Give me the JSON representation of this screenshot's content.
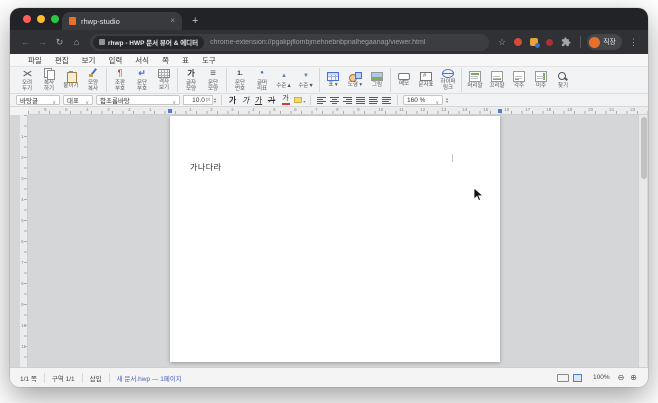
{
  "colors": {
    "accent_blue": "#4a7fd4",
    "favicon_orange": "#e8702a",
    "highlight_yellow": "#f3d96b",
    "char_color_red": "#d43b2a"
  },
  "icons": {
    "back": "←",
    "forward": "→",
    "reload": "↻",
    "home": "⌂",
    "star": "☆",
    "more": "⋮",
    "tab_close": "×",
    "new_tab": "+",
    "caret": "∨",
    "spin_up": "▴",
    "spin_down": "▾",
    "zoom_out": "⊖",
    "zoom_in": "⊕"
  },
  "browser": {
    "tab_title": "rhwp-studio",
    "extension_badge": "rhwp - HWP 문서 뷰어 & 에디터",
    "url": "chrome-extension://pgakpjflombjmehnebnbpnalhegaanag/viewer.html",
    "profile_label": "직장"
  },
  "menu": {
    "items": [
      {
        "id": "file",
        "label": "파일"
      },
      {
        "id": "edit",
        "label": "편집"
      },
      {
        "id": "view",
        "label": "보기"
      },
      {
        "id": "input",
        "label": "입력"
      },
      {
        "id": "format",
        "label": "서식"
      },
      {
        "id": "page",
        "label": "쪽"
      },
      {
        "id": "table",
        "label": "표"
      },
      {
        "id": "tools",
        "label": "도구"
      }
    ]
  },
  "toolbar": {
    "groups": [
      {
        "items": [
          {
            "name": "cut",
            "icon": "scissors-icon",
            "label": "오려\n두기"
          },
          {
            "name": "copy",
            "icon": "copy-icon",
            "label": "복사\n하기"
          },
          {
            "name": "paste",
            "icon": "paste-icon",
            "label": "붙이기"
          },
          {
            "name": "format-copy",
            "icon": "format-brush-icon",
            "label": "모양\n복사"
          }
        ]
      },
      {
        "items": [
          {
            "name": "control-marks",
            "icon": "pilcrow-icon",
            "label": "조판\n부호"
          },
          {
            "name": "paragraph-marks",
            "icon": "return-icon",
            "label": "문단\n부호"
          },
          {
            "name": "grid-view",
            "icon": "grid-view-icon",
            "label": "격자\n보기"
          }
        ]
      },
      {
        "items": [
          {
            "name": "char-shape",
            "icon": "char-shape-icon",
            "label": "글자\n모양"
          },
          {
            "name": "para-shape",
            "icon": "para-shape-icon",
            "label": "문단\n모양"
          }
        ]
      },
      {
        "items": [
          {
            "name": "para-numbering",
            "icon": "numbering-icon",
            "label": "문단\n번호"
          },
          {
            "name": "bullet-list",
            "icon": "bullet-icon",
            "label": "글머\n리표"
          },
          {
            "name": "level-up",
            "icon": "level-up-icon",
            "label": "수준▲"
          },
          {
            "name": "level-down",
            "icon": "level-down-icon",
            "label": "수준▼"
          }
        ]
      },
      {
        "items": [
          {
            "name": "insert-table",
            "icon": "table-icon",
            "label": "표 ▾"
          },
          {
            "name": "insert-shape",
            "icon": "shapes-icon",
            "label": "도형 ▾"
          },
          {
            "name": "insert-picture",
            "icon": "picture-icon",
            "label": "그림"
          }
        ]
      },
      {
        "items": [
          {
            "name": "memo",
            "icon": "memo-icon",
            "label": "메모"
          },
          {
            "name": "char-map",
            "icon": "charmap-icon",
            "label": "문자표"
          },
          {
            "name": "hyperlink",
            "icon": "hyperlink-icon",
            "label": "하이퍼\n링크"
          }
        ]
      },
      {
        "items": [
          {
            "name": "header",
            "icon": "header-icon",
            "label": "머리말"
          },
          {
            "name": "footer",
            "icon": "footer-icon",
            "label": "꼬리말"
          },
          {
            "name": "footnote",
            "icon": "footnote-icon",
            "label": "각주"
          },
          {
            "name": "endnote",
            "icon": "endnote-icon",
            "label": "미주"
          },
          {
            "name": "find",
            "icon": "find-icon",
            "label": "찾기"
          }
        ]
      }
    ]
  },
  "format_bar": {
    "style_value": "바탕글",
    "lang_value": "대표",
    "font_value": "함초롬바탕",
    "size_value": "10.0",
    "size_unit": "pt",
    "text_buttons": [
      {
        "style": "bold",
        "label": "가"
      },
      {
        "style": "italic",
        "label": "가"
      },
      {
        "style": "underline",
        "label": "가"
      },
      {
        "style": "strike",
        "label": "가"
      }
    ],
    "char_color_label": "가",
    "alignments": [
      "left",
      "center",
      "right",
      "justify",
      "distribute",
      "divide"
    ],
    "line_spacing_value": "160 %"
  },
  "ruler": {
    "h_left_numbers": [
      "6",
      "5",
      "4",
      "3",
      "2",
      "1"
    ],
    "h_numbers": [
      "1",
      "2",
      "3",
      "4",
      "5",
      "6",
      "7",
      "8",
      "9",
      "10",
      "11",
      "12",
      "13",
      "14",
      "15",
      "16",
      "17",
      "18",
      "19",
      "20",
      "21",
      "22"
    ],
    "v_numbers": [
      "1",
      "2",
      "3",
      "4",
      "5",
      "6",
      "7",
      "8",
      "9",
      "10",
      "11"
    ]
  },
  "document": {
    "text": "가나다라"
  },
  "status_bar": {
    "segments": [
      {
        "id": "page-count",
        "label": "1/1 쪽"
      },
      {
        "id": "section",
        "label": "구역 1/1"
      },
      {
        "id": "insert-mode",
        "label": "삽입"
      }
    ],
    "file_info": "새 문서.hwp — 1페이지",
    "zoom_level": "100%"
  }
}
